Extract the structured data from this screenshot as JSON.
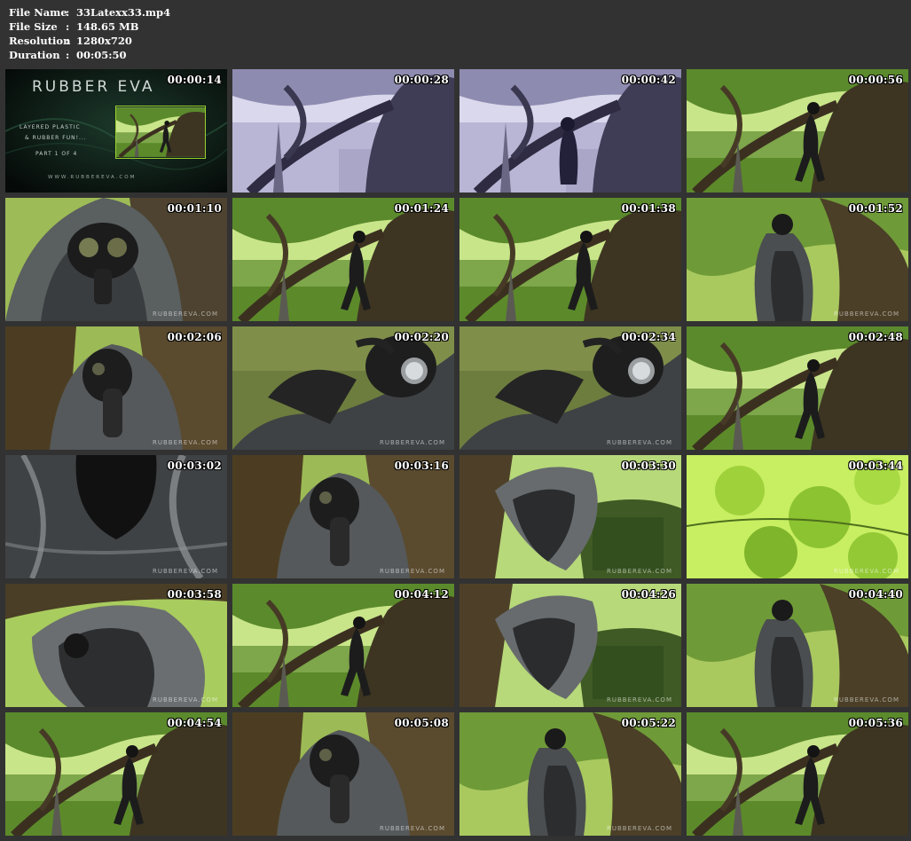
{
  "info": {
    "file_name_label": "File Name",
    "file_name": "33Latexx33.mp4",
    "file_size_label": "File Size",
    "file_size": "148.65 MB",
    "resolution_label": "Resolution",
    "resolution": "1280x720",
    "duration_label": "Duration",
    "duration": "00:05:50",
    "separator": ":"
  },
  "title_card": {
    "brand": "RUBBER EVA",
    "subtitle_line1": "LAYERED PLASTIC",
    "subtitle_line2": "& RUBBER FUN!...",
    "part": "PART 1 OF 4",
    "url": "WWW.RUBBEREVA.COM"
  },
  "watermark": "RUBBEREVA.COM",
  "thumbnails": [
    {
      "time": "00:00:14",
      "scene": "title"
    },
    {
      "time": "00:00:28",
      "scene": "tree-mono"
    },
    {
      "time": "00:00:42",
      "scene": "tree-mono-figure"
    },
    {
      "time": "00:00:56",
      "scene": "tree-figure-sit"
    },
    {
      "time": "00:01:10",
      "scene": "closeup-mask"
    },
    {
      "time": "00:01:24",
      "scene": "tree-figure-sit"
    },
    {
      "time": "00:01:38",
      "scene": "tree-figure-sit"
    },
    {
      "time": "00:01:52",
      "scene": "figure-trunk"
    },
    {
      "time": "00:02:06",
      "scene": "closeup-hood"
    },
    {
      "time": "00:02:20",
      "scene": "lying-mask"
    },
    {
      "time": "00:02:34",
      "scene": "lying-mask"
    },
    {
      "time": "00:02:48",
      "scene": "tree-figure-sit"
    },
    {
      "time": "00:03:02",
      "scene": "closeup-plastic"
    },
    {
      "time": "00:03:16",
      "scene": "closeup-hood"
    },
    {
      "time": "00:03:30",
      "scene": "ivy-trunk-figure"
    },
    {
      "time": "00:03:44",
      "scene": "leaves"
    },
    {
      "time": "00:03:58",
      "scene": "figure-crouch"
    },
    {
      "time": "00:04:12",
      "scene": "tree-figure-sit"
    },
    {
      "time": "00:04:26",
      "scene": "ivy-trunk-figure"
    },
    {
      "time": "00:04:40",
      "scene": "figure-trunk"
    },
    {
      "time": "00:04:54",
      "scene": "tree-figure-sit"
    },
    {
      "time": "00:05:08",
      "scene": "closeup-hood"
    },
    {
      "time": "00:05:22",
      "scene": "figure-trunk"
    },
    {
      "time": "00:05:36",
      "scene": "tree-figure-sit"
    }
  ]
}
